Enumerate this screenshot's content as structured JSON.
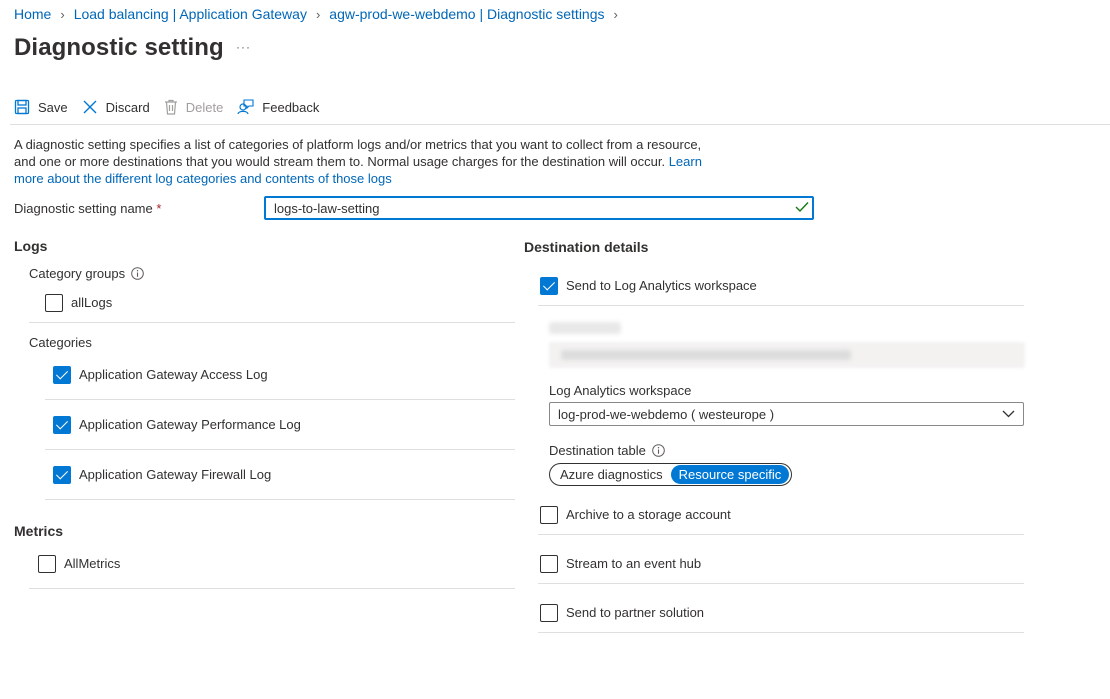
{
  "breadcrumb": {
    "items": [
      "Home",
      "Load balancing | Application Gateway",
      "agw-prod-we-webdemo | Diagnostic settings"
    ]
  },
  "page": {
    "title": "Diagnostic setting",
    "more": "···"
  },
  "toolbar": {
    "save": "Save",
    "discard": "Discard",
    "delete": "Delete",
    "feedback": "Feedback"
  },
  "description": {
    "text": "A diagnostic setting specifies a list of categories of platform logs and/or metrics that you want to collect from a resource, and one or more destinations that you would stream them to. Normal usage charges for the destination will occur. ",
    "link": "Learn more about the different log categories and contents of those logs"
  },
  "name_field": {
    "label": "Diagnostic setting name",
    "required_mark": "*",
    "value": "logs-to-law-setting"
  },
  "logs": {
    "title": "Logs",
    "category_groups_label": "Category groups",
    "groups": [
      {
        "label": "allLogs",
        "checked": false
      }
    ],
    "categories_label": "Categories",
    "categories": [
      {
        "label": "Application Gateway Access Log",
        "checked": true
      },
      {
        "label": "Application Gateway Performance Log",
        "checked": true
      },
      {
        "label": "Application Gateway Firewall Log",
        "checked": true
      }
    ]
  },
  "metrics": {
    "title": "Metrics",
    "items": [
      {
        "label": "AllMetrics",
        "checked": false
      }
    ]
  },
  "destination": {
    "title": "Destination details",
    "log_analytics": {
      "label": "Send to Log Analytics workspace",
      "checked": true
    },
    "workspace_label": "Log Analytics workspace",
    "workspace_value": "log-prod-we-webdemo ( westeurope )",
    "table_label": "Destination table",
    "table_options": [
      "Azure diagnostics",
      "Resource specific"
    ],
    "table_selected": "Resource specific",
    "storage": {
      "label": "Archive to a storage account",
      "checked": false
    },
    "event_hub": {
      "label": "Stream to an event hub",
      "checked": false
    },
    "partner": {
      "label": "Send to partner solution",
      "checked": false
    }
  },
  "colors": {
    "accent": "#0078d4",
    "link": "#0067b8",
    "valid": "#107c10",
    "text": "#323130",
    "divider": "#e1dfdd"
  }
}
